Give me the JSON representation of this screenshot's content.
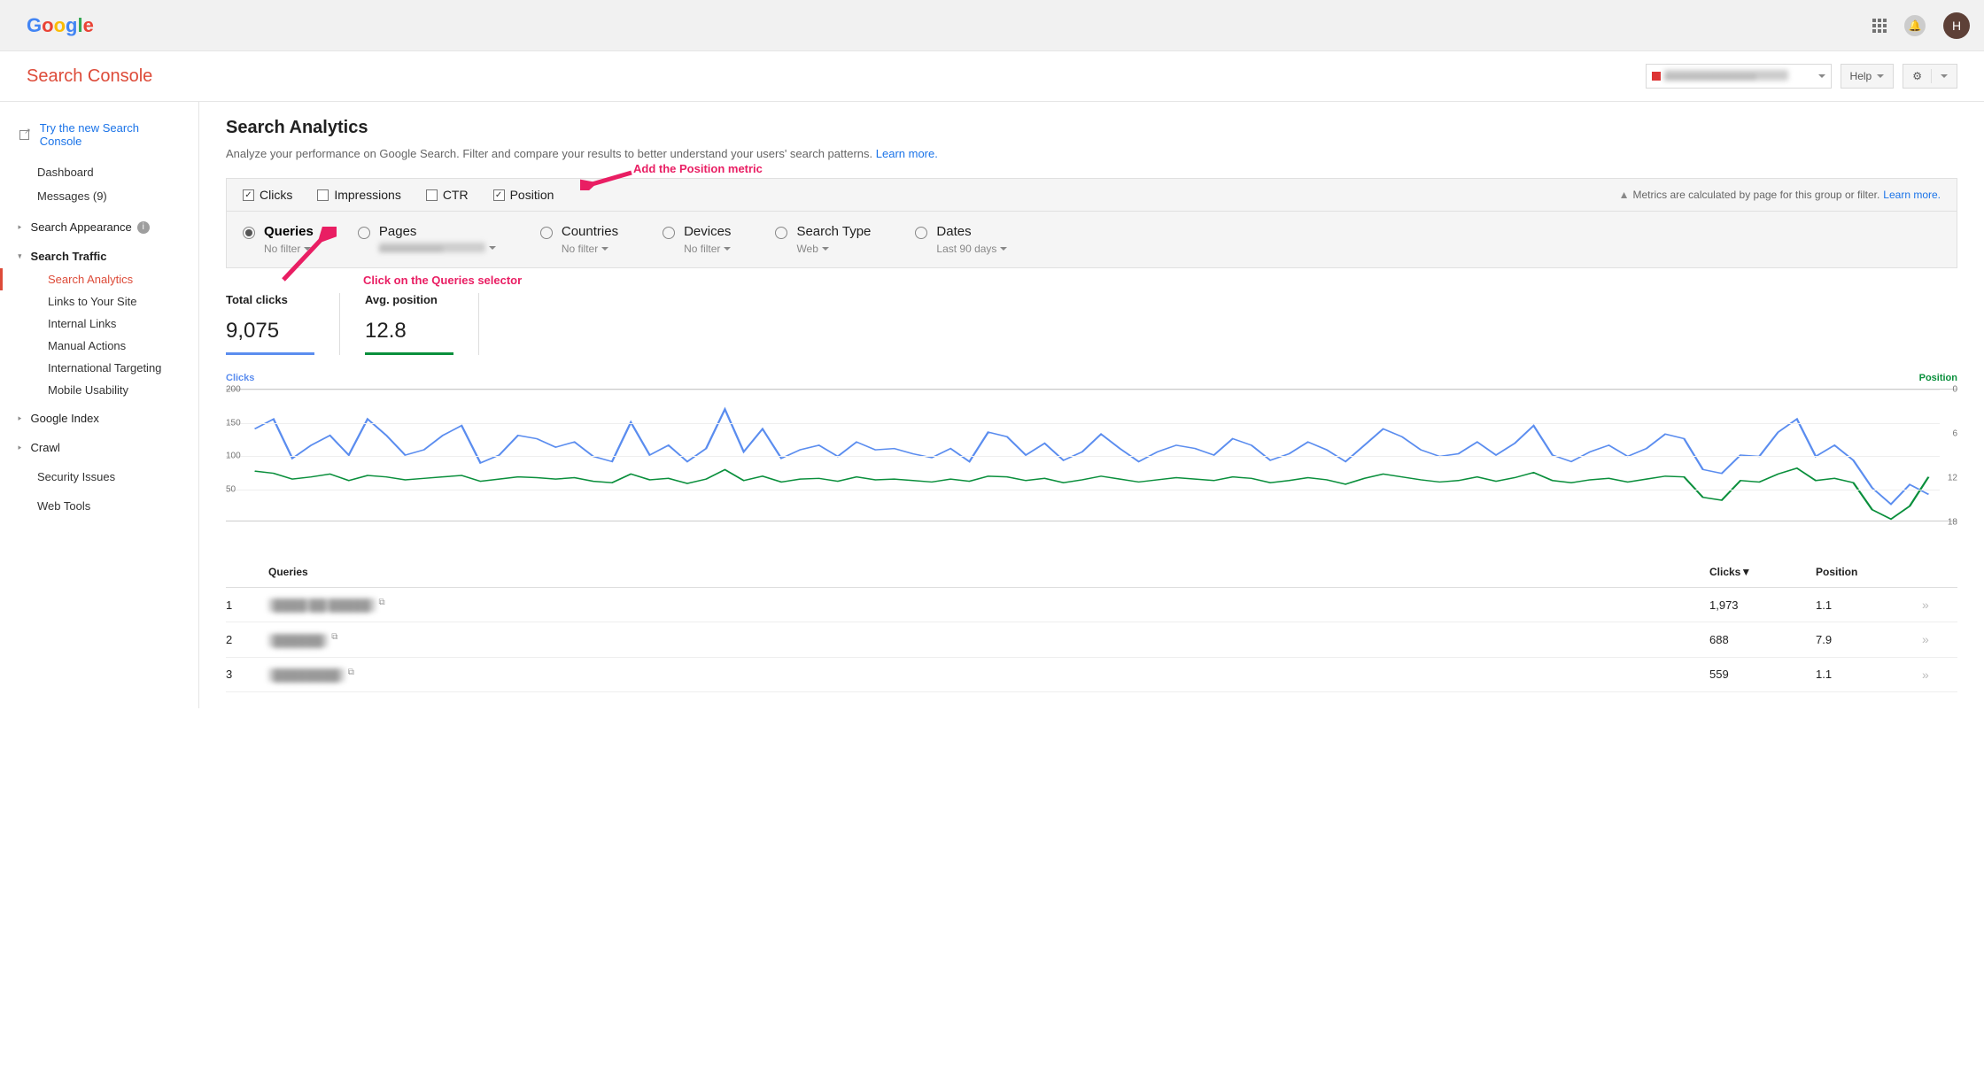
{
  "topbar": {
    "logo_chars": [
      "G",
      "o",
      "o",
      "g",
      "l",
      "e"
    ],
    "logo_colors": [
      "#4285F4",
      "#EA4335",
      "#FBBC05",
      "#4285F4",
      "#34A853",
      "#EA4335"
    ],
    "avatar_letter": "H"
  },
  "header": {
    "app_title": "Search Console",
    "help_label": "Help"
  },
  "sidebar": {
    "try_new": "Try the new Search Console",
    "dashboard": "Dashboard",
    "messages": "Messages (9)",
    "search_appearance": "Search Appearance",
    "search_traffic": "Search Traffic",
    "subs": [
      "Search Analytics",
      "Links to Your Site",
      "Internal Links",
      "Manual Actions",
      "International Targeting",
      "Mobile Usability"
    ],
    "google_index": "Google Index",
    "crawl": "Crawl",
    "security": "Security Issues",
    "webtools": "Web Tools"
  },
  "page": {
    "title": "Search Analytics",
    "subtitle": "Analyze your performance on Google Search. Filter and compare your results to better understand your users' search patterns. ",
    "learn_more": "Learn more."
  },
  "metrics": {
    "clicks": "Clicks",
    "impressions": "Impressions",
    "ctr": "CTR",
    "position": "Position"
  },
  "warning": {
    "text": "Metrics are calculated by page for this group or filter. ",
    "link": "Learn more."
  },
  "dimensions": {
    "queries": {
      "label": "Queries",
      "sub": "No filter"
    },
    "pages": {
      "label": "Pages"
    },
    "countries": {
      "label": "Countries",
      "sub": "No filter"
    },
    "devices": {
      "label": "Devices",
      "sub": "No filter"
    },
    "search_type": {
      "label": "Search Type",
      "sub": "Web"
    },
    "dates": {
      "label": "Dates",
      "sub": "Last 90 days"
    }
  },
  "annotations": {
    "position": "Add the Position metric",
    "queries": "Click on the Queries selector"
  },
  "totals": {
    "clicks_label": "Total clicks",
    "clicks_value": "9,075",
    "pos_label": "Avg. position",
    "pos_value": "12.8"
  },
  "chart_data": {
    "type": "line",
    "left_axis": {
      "label": "Clicks",
      "ticks": [
        200,
        150,
        100,
        50
      ],
      "color": "#5b8def"
    },
    "right_axis": {
      "label": "Position",
      "ticks": [
        0,
        6,
        12,
        18
      ],
      "color": "#0a8f3c"
    },
    "series": [
      {
        "name": "Clicks",
        "axis": "left",
        "color": "#5b8def",
        "values": [
          140,
          155,
          95,
          115,
          130,
          100,
          155,
          130,
          100,
          108,
          130,
          145,
          88,
          100,
          130,
          125,
          112,
          120,
          98,
          90,
          150,
          100,
          115,
          90,
          110,
          170,
          105,
          140,
          95,
          108,
          115,
          98,
          120,
          108,
          110,
          102,
          96,
          110,
          90,
          135,
          128,
          100,
          118,
          92,
          105,
          132,
          110,
          90,
          105,
          115,
          110,
          100,
          125,
          115,
          92,
          102,
          120,
          108,
          90,
          115,
          140,
          128,
          108,
          98,
          102,
          120,
          100,
          118,
          145,
          100,
          90,
          105,
          115,
          98,
          110,
          132,
          125,
          78,
          72,
          100,
          98,
          135,
          155,
          98,
          115,
          92,
          50,
          25,
          55,
          40
        ]
      },
      {
        "name": "Position",
        "axis": "right",
        "color": "#0a8f3c",
        "values": [
          11.2,
          11.5,
          12.3,
          12.0,
          11.6,
          12.5,
          11.8,
          12.0,
          12.4,
          12.2,
          12.0,
          11.8,
          12.6,
          12.3,
          12.0,
          12.1,
          12.3,
          12.1,
          12.6,
          12.8,
          11.6,
          12.4,
          12.2,
          12.9,
          12.3,
          11.0,
          12.5,
          11.9,
          12.7,
          12.3,
          12.2,
          12.6,
          12.0,
          12.4,
          12.3,
          12.5,
          12.7,
          12.3,
          12.6,
          11.9,
          12.0,
          12.5,
          12.2,
          12.8,
          12.4,
          11.9,
          12.3,
          12.7,
          12.4,
          12.1,
          12.3,
          12.5,
          12.0,
          12.2,
          12.8,
          12.5,
          12.1,
          12.4,
          13.0,
          12.2,
          11.6,
          12.0,
          12.4,
          12.7,
          12.5,
          12.0,
          12.6,
          12.1,
          11.4,
          12.5,
          12.8,
          12.4,
          12.2,
          12.7,
          12.3,
          11.9,
          12.0,
          14.8,
          15.2,
          12.5,
          12.7,
          11.6,
          10.8,
          12.5,
          12.2,
          12.8,
          16.5,
          17.8,
          16.0,
          12.0
        ]
      }
    ]
  },
  "table": {
    "head_queries": "Queries",
    "head_clicks": "Clicks▼",
    "head_position": "Position",
    "rows": [
      {
        "idx": "1",
        "query": "████ ██ █████",
        "clicks": "1,973",
        "position": "1.1"
      },
      {
        "idx": "2",
        "query": "██████",
        "clicks": "688",
        "position": "7.9"
      },
      {
        "idx": "3",
        "query": "████████",
        "clicks": "559",
        "position": "1.1"
      }
    ]
  }
}
